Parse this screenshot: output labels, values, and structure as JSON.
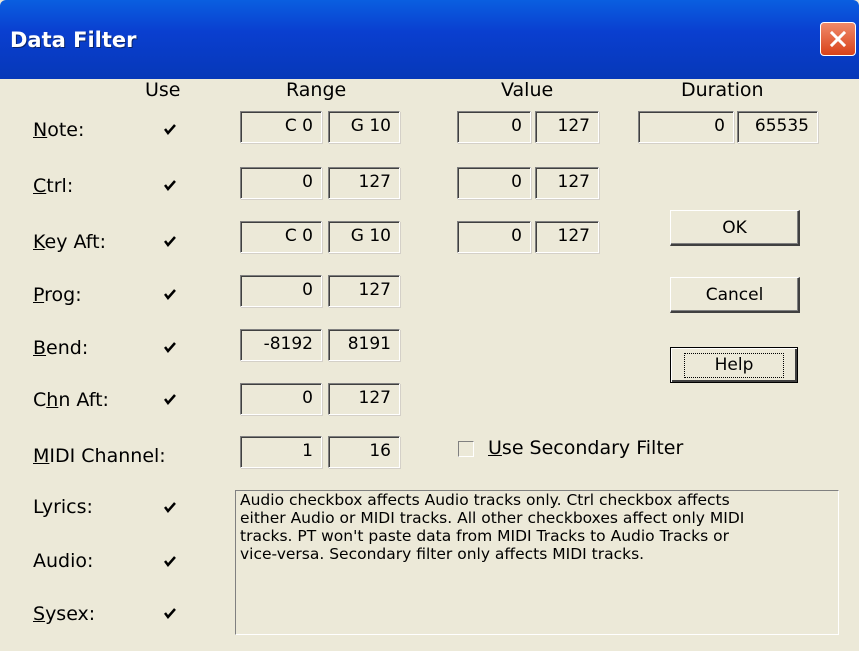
{
  "window": {
    "title": "Data Filter"
  },
  "headers": {
    "use": "Use",
    "range": "Range",
    "value": "Value",
    "duration": "Duration"
  },
  "rows": {
    "note": {
      "mnemonic": "N",
      "rest": "ote:",
      "use_checked": true,
      "range_from": "C 0",
      "range_to": "G 10",
      "value_from": "0",
      "value_to": "127",
      "duration_from": "0",
      "duration_to": "65535"
    },
    "ctrl": {
      "mnemonic": "C",
      "rest": "trl:",
      "use_checked": true,
      "range_from": "0",
      "range_to": "127",
      "value_from": "0",
      "value_to": "127"
    },
    "key_aft": {
      "mnemonic": "K",
      "rest": "ey Aft:",
      "use_checked": true,
      "range_from": "C 0",
      "range_to": "G 10",
      "value_from": "0",
      "value_to": "127"
    },
    "prog": {
      "mnemonic": "P",
      "rest": "rog:",
      "use_checked": true,
      "range_from": "0",
      "range_to": "127"
    },
    "bend": {
      "mnemonic": "B",
      "rest": "end:",
      "use_checked": true,
      "range_from": "-8192",
      "range_to": "8191"
    },
    "chn_aft": {
      "pre": "C",
      "mnemonic": "h",
      "rest": "n Aft:",
      "use_checked": true,
      "range_from": "0",
      "range_to": "127"
    }
  },
  "midi_channel": {
    "mnemonic": "M",
    "rest": "IDI Channel:",
    "from": "1",
    "to": "16"
  },
  "secondary_filter": {
    "mnemonic": "U",
    "rest": "se Secondary Filter",
    "checked": false
  },
  "lyrics": {
    "label": "Lyrics:",
    "checked": true
  },
  "audio": {
    "label": "Audio:",
    "checked": true
  },
  "sysex": {
    "mnemonic": "S",
    "rest": "ysex:",
    "checked": true
  },
  "buttons": {
    "ok": "OK",
    "cancel": "Cancel",
    "help": "Help"
  },
  "info_text": "Audio checkbox affects Audio tracks only.  Ctrl checkbox affects\neither Audio or MIDI tracks.   All other checkboxes affect only MIDI\ntracks.  PT won't paste data from MIDI Tracks to Audio Tracks or\nvice-versa.  Secondary filter only affects MIDI tracks."
}
